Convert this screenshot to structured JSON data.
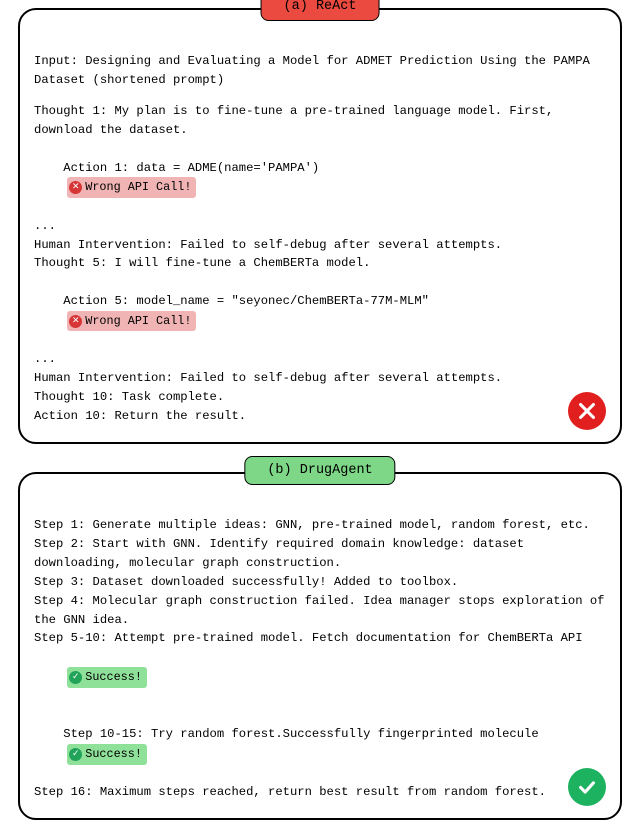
{
  "panelA": {
    "tag": "(a) ReAct",
    "input": "Input: Designing and Evaluating a Model for ADMET Prediction Using the PAMPA Dataset (shortened prompt)",
    "thought1": "Thought 1: My plan is to fine-tune a pre-trained language model. First, download the dataset.",
    "action1_pre": "Action 1: data = ADME(name='PAMPA')",
    "wrong_api": "Wrong API Call!",
    "dots1": "...",
    "human1": "Human Intervention: Failed to self-debug after several attempts.",
    "thought5": "Thought 5: I will fine-tune a ChemBERTa model.",
    "action5_pre": "Action 5: model_name = \"seyonec/ChemBERTa-77M-MLM\"",
    "dots2": "...",
    "human2": "Human Intervention: Failed to self-debug after several attempts.",
    "thought10": "Thought 10: Task complete.",
    "action10": "Action 10: Return the result."
  },
  "panelB": {
    "tag": "(b) DrugAgent",
    "step1": "Step 1: Generate multiple ideas: GNN, pre-trained model, random forest, etc.",
    "step2": "Step 2: Start with GNN. Identify required domain knowledge: dataset downloading, molecular graph construction.",
    "step3": "Step 3: Dataset downloaded successfully! Added to toolbox.",
    "step4": "Step 4: Molecular graph construction failed. Idea manager stops exploration of the GNN idea.",
    "step5_10": "Step 5-10: Attempt pre-trained model. Fetch documentation for ChemBERTa API",
    "success": "Success!",
    "step10_15": "Step 10-15: Try random forest.Successfully fingerprinted molecule",
    "step16": "Step 16: Maximum steps reached, return best result from random forest."
  }
}
